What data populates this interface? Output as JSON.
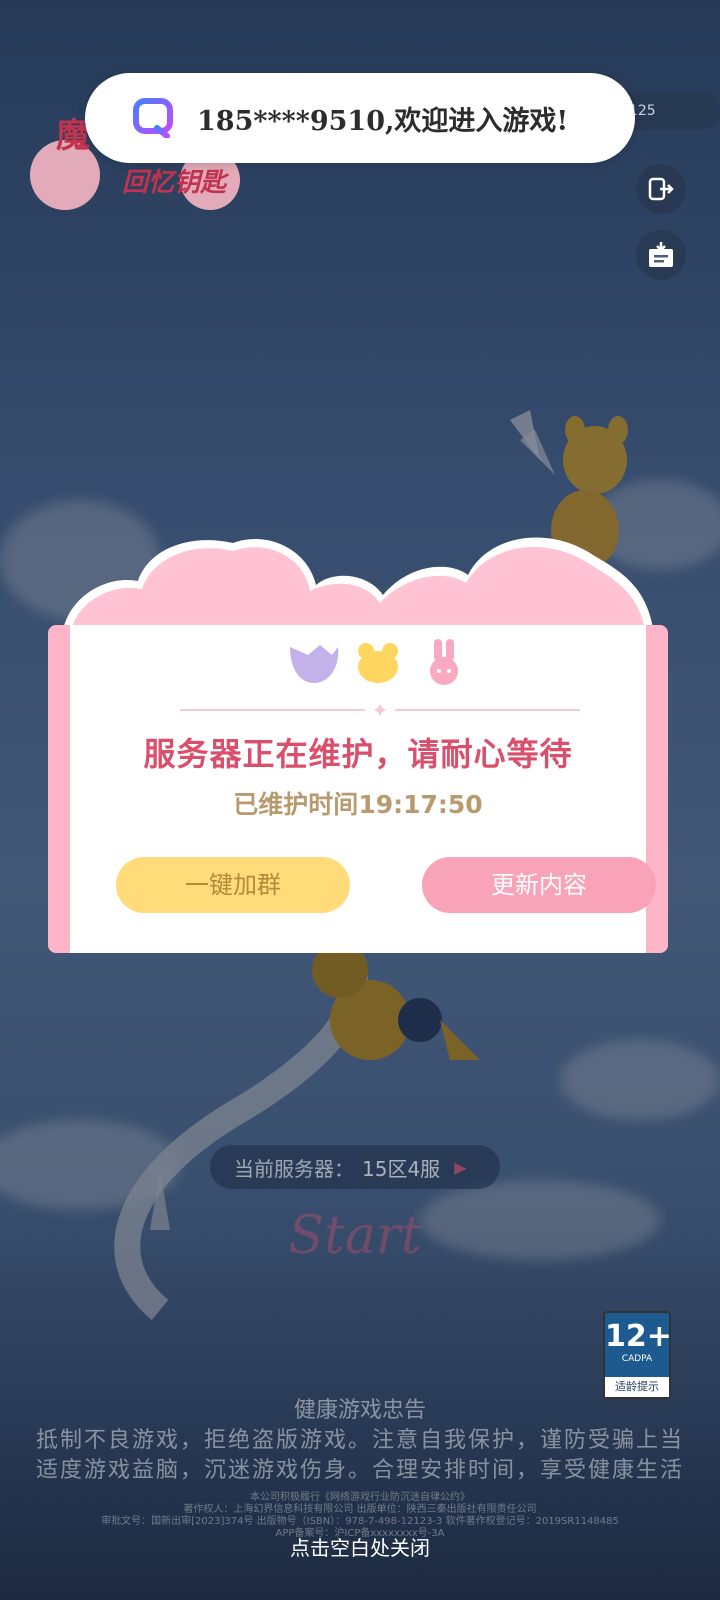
{
  "toast": {
    "icon": "chat-bubble-q-icon",
    "text": "185****9510,欢迎进入游戏!"
  },
  "account_pill": {
    "text": "4125"
  },
  "logo": {
    "title": "魔",
    "subtitle": "回忆钥匙"
  },
  "side_buttons": [
    {
      "icon": "logout-icon"
    },
    {
      "icon": "notice-board-icon"
    }
  ],
  "modal": {
    "title": "服务器正在维护，请耐心等待",
    "elapsed_label": "已维护时间",
    "elapsed_value": "19:17:50",
    "join_button": "一键加群",
    "update_button": "更新内容",
    "colors": {
      "accent": "#d94f6c",
      "join": "#ffdb7a",
      "update": "#f9a3b9",
      "frame": "#ffb5c8"
    }
  },
  "server": {
    "label": "当前服务器：",
    "value": "15区4服"
  },
  "start_button": {
    "text": "Start"
  },
  "age_rating": {
    "number": "12+",
    "org": "CADPA",
    "tip": "适龄提示"
  },
  "health_notice": {
    "title": "健康游戏忠告",
    "line1": "抵制不良游戏，拒绝盗版游戏。注意自我保护，谨防受骗上当",
    "line2": "适度游戏益脑，沉迷游戏伤身。合理安排时间，享受健康生活"
  },
  "fine_print": {
    "line1": "本公司积极履行《网络游戏行业防沉迷自律公约》",
    "line2": "著作权人：上海幻界信息科技有限公司 出版单位：陕西三秦出版社有限责任公司",
    "line3": "审批文号：国新出审[2023]374号 出版物号（ISBN）：978-7-498-12123-3 软件著作权登记号：2019SR1148485",
    "line4": "APP备案号：沪ICP备xxxxxxxx号-3A"
  },
  "close_hint": "点击空白处关闭"
}
